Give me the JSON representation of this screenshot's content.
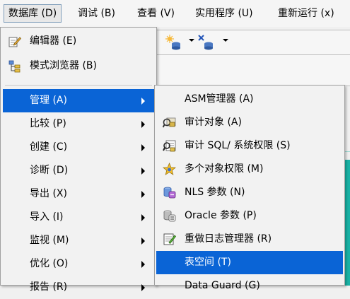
{
  "menubar": {
    "items": [
      {
        "label": "数据库 (D)",
        "active": true
      },
      {
        "label": "调试 (B)"
      },
      {
        "label": "查看 (V)"
      },
      {
        "label": "实用程序 (U)"
      },
      {
        "label": "重新运行 (x)"
      }
    ]
  },
  "database_menu": {
    "items": [
      {
        "label": "编辑器 (E)",
        "icon": "pencil-edit-icon"
      },
      {
        "label": "模式浏览器 (B)",
        "icon": "schema-browser-icon"
      },
      {
        "label": "管理 (A)",
        "submenu": true,
        "selected": true
      },
      {
        "label": "比较 (P)",
        "submenu": true
      },
      {
        "label": "创建 (C)",
        "submenu": true
      },
      {
        "label": "诊断 (D)",
        "submenu": true
      },
      {
        "label": "导出 (X)",
        "submenu": true
      },
      {
        "label": "导入 (I)",
        "submenu": true
      },
      {
        "label": "监视 (M)",
        "submenu": true
      },
      {
        "label": "优化 (O)",
        "submenu": true
      },
      {
        "label": "报告 (R)",
        "submenu": true
      }
    ]
  },
  "admin_submenu": {
    "items": [
      {
        "label": "ASM管理器 (A)",
        "icon": ""
      },
      {
        "label": "审计对象 (A)",
        "icon": "audit-objects-icon"
      },
      {
        "label": "审计 SQL/ 系统权限 (S)",
        "icon": "audit-sql-icon"
      },
      {
        "label": "多个对象权限 (M)",
        "icon": "star-privileges-icon"
      },
      {
        "label": "NLS 参数 (N)",
        "icon": "nls-params-icon"
      },
      {
        "label": "Oracle 参数 (P)",
        "icon": "oracle-params-icon"
      },
      {
        "label": "重做日志管理器 (R)",
        "icon": "redo-log-icon"
      },
      {
        "label": "表空间 (T)",
        "icon": "",
        "selected": true
      },
      {
        "label": "Data Guard (G)",
        "icon": ""
      }
    ]
  },
  "toolbar": {
    "buttons": [
      {
        "icon": "new-connection-icon"
      },
      {
        "icon": "disconnect-icon"
      }
    ]
  },
  "colors": {
    "selection": "#0a64d6",
    "teal_panel": "#19b3a6"
  }
}
